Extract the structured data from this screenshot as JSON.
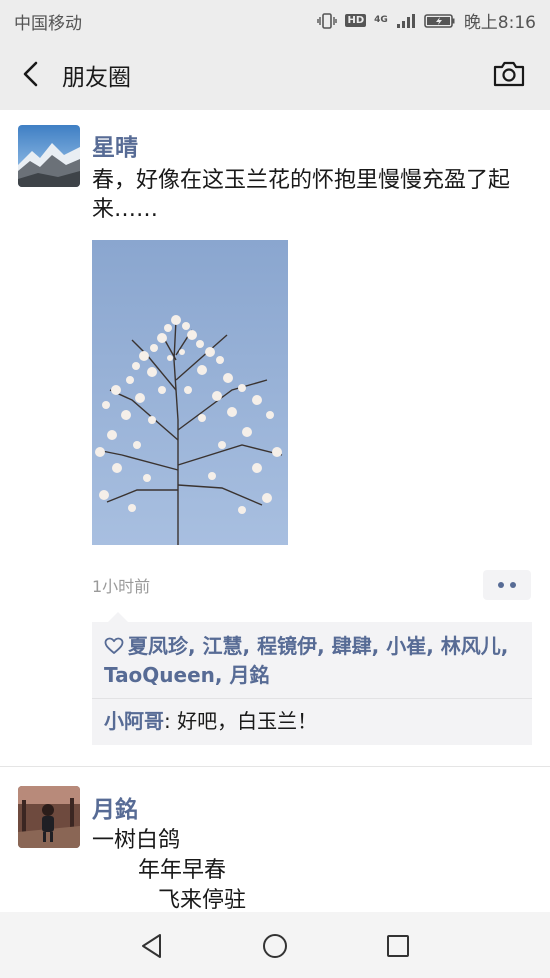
{
  "status_bar": {
    "carrier": "中国移动",
    "hd": "HD",
    "network": "4G",
    "time": "晚上8:16"
  },
  "header": {
    "title": "朋友圈",
    "back_icon": "back-chevron-icon",
    "camera_icon": "camera-icon"
  },
  "posts": [
    {
      "author": "星晴",
      "text": "春，好像在这玉兰花的怀抱里慢慢充盈了起来……",
      "time": "1小时前",
      "likes": "夏凤珍, 江慧, 程镜伊, 肆肆, 小崔, 林风儿, TaoQueen, 月銘",
      "comments": [
        {
          "user": "小阿哥",
          "text": ": 好吧，白玉兰！"
        }
      ]
    },
    {
      "author": "月銘",
      "lines": [
        "一树白鸽",
        "年年早春",
        "飞来停驻"
      ]
    }
  ],
  "colors": {
    "link": "#576b95",
    "header_bg": "#ededed",
    "comment_bg": "#f3f3f5"
  }
}
